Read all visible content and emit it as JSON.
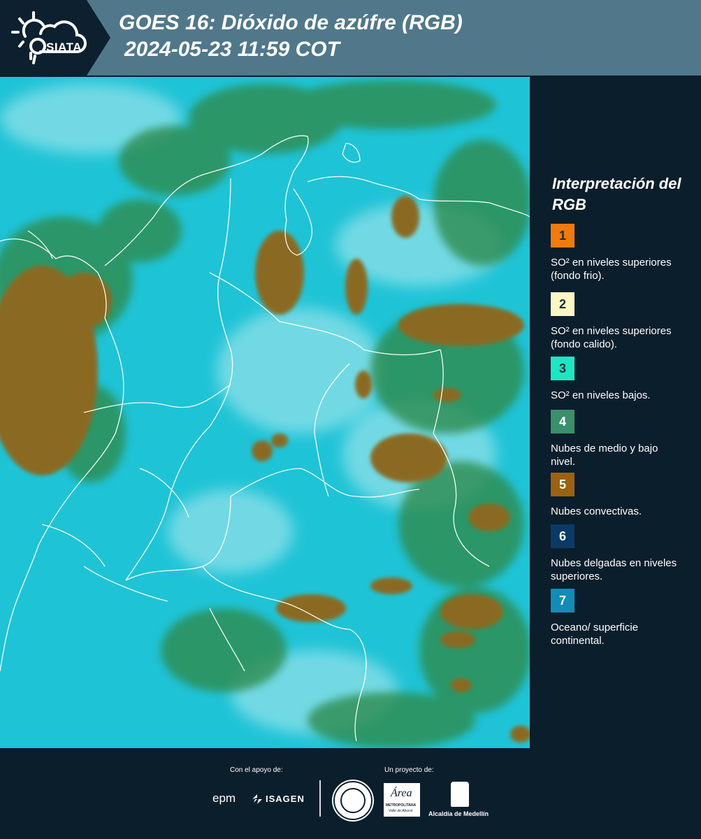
{
  "header": {
    "logo_text": "SIATA",
    "title_line1": "GOES 16: Dióxido de azúfre (RGB)",
    "title_line2": "2024-05-23 11:59 COT"
  },
  "map": {
    "base_color": "#1fc3d6",
    "cloud_colors": {
      "green": "#2e8b4e",
      "brown": "#8a6a22",
      "white": "#d8f4f6"
    }
  },
  "legend": {
    "title": "Interpretación del RGB",
    "items": [
      {
        "number": "1",
        "color": "#f07a0e",
        "label": "SO² en niveles superiores (fondo frio)."
      },
      {
        "number": "2",
        "color": "#fbf6c4",
        "label": "SO² en niveles superiores (fondo calido)."
      },
      {
        "number": "3",
        "color": "#1ee6c3",
        "label": "SO² en niveles bajos."
      },
      {
        "number": "4",
        "color": "#3b8f6a",
        "label": "Nubes de medio y bajo nivel."
      },
      {
        "number": "5",
        "color": "#9a6212",
        "label": "Nubes convectivas."
      },
      {
        "number": "6",
        "color": "#0c3a66",
        "label": "Nubes delgadas en niveles superiores."
      },
      {
        "number": "7",
        "color": "#138bb7",
        "label": "Oceano/ superficie continental."
      }
    ]
  },
  "footer": {
    "support_label": "Con el apoyo de:",
    "project_label": "Un proyecto de:",
    "epm": "epm",
    "isagen": "ISAGEN",
    "area_name": "Área",
    "area_sub1": "METROPOLITANA",
    "area_sub2": "Valle de Aburrá",
    "alcaldia": "Alcaldía de Medellín"
  }
}
